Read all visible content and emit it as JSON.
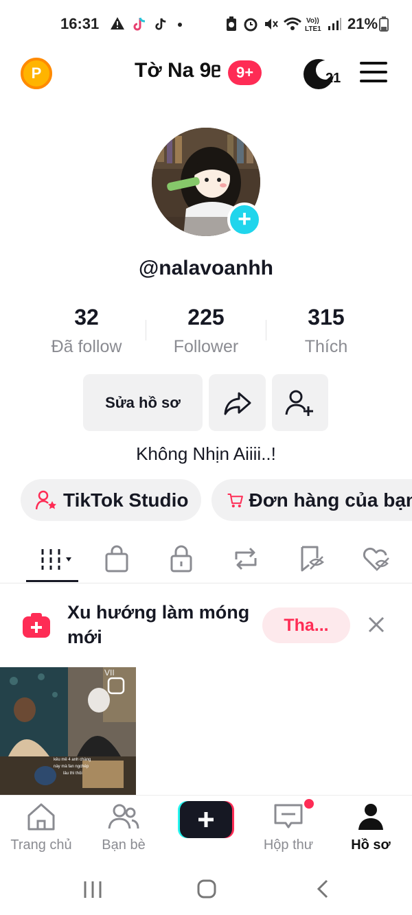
{
  "status_bar": {
    "time": "16:31",
    "battery": "21%"
  },
  "header": {
    "username": "Tờ Na 9ᥱ",
    "notification_badge": "9+",
    "streak_count": "21"
  },
  "profile": {
    "handle": "@nalavoanhh",
    "stats": [
      {
        "value": "32",
        "label": "Đã follow"
      },
      {
        "value": "225",
        "label": "Follower"
      },
      {
        "value": "315",
        "label": "Thích"
      }
    ],
    "edit_button": "Sửa hồ sơ",
    "bio": "Không Nhịn Aiiii..!"
  },
  "pills": {
    "studio": "TikTok Studio",
    "orders": "Đơn hàng của bạn"
  },
  "tabs": [
    "videos",
    "shop",
    "private",
    "reposts",
    "favorites",
    "liked"
  ],
  "banner": {
    "title": "Xu hướng làm móng mới",
    "cta": "Tha..."
  },
  "video_caption": [
    "kêu mê 4 anh chàng",
    "này mà fan ngchép",
    "lâu thì thôi"
  ],
  "bottom_nav": {
    "home": "Trang chủ",
    "friends": "Bạn bè",
    "inbox": "Hộp thư",
    "profile": "Hồ sơ"
  },
  "colors": {
    "accent": "#fe2c55",
    "cyan": "#20d5ec",
    "muted": "#8a8b91"
  }
}
